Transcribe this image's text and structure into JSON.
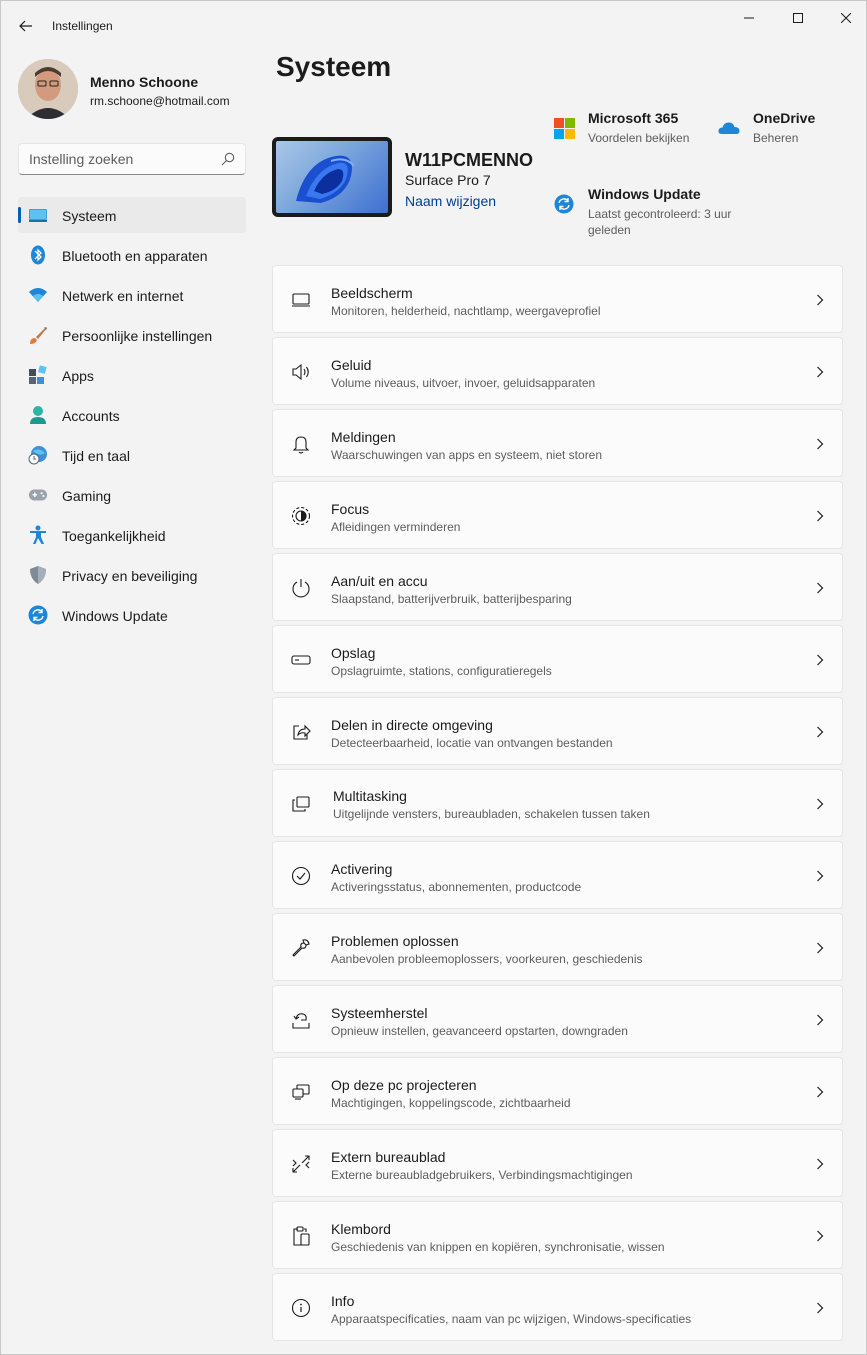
{
  "window": {
    "title": "Instellingen",
    "controls": {
      "minimize": "minimize-icon",
      "maximize": "maximize-icon",
      "close": "close-icon"
    }
  },
  "profile": {
    "name": "Menno Schoone",
    "email": "rm.schoone@hotmail.com"
  },
  "search": {
    "placeholder": "Instelling zoeken",
    "value": ""
  },
  "sidebar": {
    "items": [
      {
        "label": "Systeem",
        "icon": "system-icon",
        "active": true
      },
      {
        "label": "Bluetooth en apparaten",
        "icon": "bluetooth-icon"
      },
      {
        "label": "Netwerk en internet",
        "icon": "wifi-icon"
      },
      {
        "label": "Persoonlijke instellingen",
        "icon": "brush-icon"
      },
      {
        "label": "Apps",
        "icon": "apps-icon"
      },
      {
        "label": "Accounts",
        "icon": "accounts-icon"
      },
      {
        "label": "Tijd en taal",
        "icon": "time-language-icon"
      },
      {
        "label": "Gaming",
        "icon": "gamepad-icon"
      },
      {
        "label": "Toegankelijkheid",
        "icon": "accessibility-icon"
      },
      {
        "label": "Privacy en beveiliging",
        "icon": "shield-icon"
      },
      {
        "label": "Windows Update",
        "icon": "windows-update-icon"
      }
    ]
  },
  "main": {
    "title": "Systeem",
    "device": {
      "name": "W11PCMENNO",
      "model": "Surface Pro 7",
      "rename_link": "Naam wijzigen"
    },
    "quick_links": {
      "m365": {
        "title": "Microsoft 365",
        "subtitle": "Voordelen bekijken",
        "icon": "microsoft-logo-icon"
      },
      "onedrive": {
        "title": "OneDrive",
        "subtitle": "Beheren",
        "icon": "onedrive-icon"
      },
      "update": {
        "title": "Windows Update",
        "subtitle": "Laatst gecontroleerd: 3 uur",
        "subtitle2": "geleden",
        "icon": "windows-update-icon"
      }
    },
    "cards": [
      {
        "title": "Beeldscherm",
        "subtitle": "Monitoren, helderheid, nachtlamp, weergaveprofiel",
        "icon": "display-icon"
      },
      {
        "title": "Geluid",
        "subtitle": "Volume niveaus, uitvoer, invoer, geluidsapparaten",
        "icon": "speaker-icon"
      },
      {
        "title": "Meldingen",
        "subtitle": "Waarschuwingen van apps en systeem, niet storen",
        "icon": "bell-icon"
      },
      {
        "title": "Focus",
        "subtitle": "Afleidingen verminderen",
        "icon": "focus-icon"
      },
      {
        "title": "Aan/uit en accu",
        "subtitle": "Slaapstand, batterijverbruik, batterijbesparing",
        "icon": "power-icon"
      },
      {
        "title": "Opslag",
        "subtitle": "Opslagruimte, stations, configuratieregels",
        "icon": "storage-icon"
      },
      {
        "title": "Delen in directe omgeving",
        "subtitle": "Detecteerbaarheid, locatie van ontvangen bestanden",
        "icon": "share-icon"
      },
      {
        "title": "Multitasking",
        "subtitle": "Uitgelijnde vensters, bureaubladen, schakelen tussen taken",
        "icon": "multitasking-icon"
      },
      {
        "title": "Activering",
        "subtitle": "Activeringsstatus, abonnementen, productcode",
        "icon": "checkmark-circle-icon"
      },
      {
        "title": "Problemen oplossen",
        "subtitle": "Aanbevolen probleemoplossers, voorkeuren, geschiedenis",
        "icon": "wrench-icon"
      },
      {
        "title": "Systeemherstel",
        "subtitle": "Opnieuw instellen, geavanceerd opstarten, downgraden",
        "icon": "recovery-icon"
      },
      {
        "title": "Op deze pc projecteren",
        "subtitle": "Machtigingen, koppelingscode, zichtbaarheid",
        "icon": "project-icon"
      },
      {
        "title": "Extern bureaublad",
        "subtitle": "Externe bureaubladgebruikers, Verbindingsmachtigingen",
        "icon": "remote-desktop-icon"
      },
      {
        "title": "Klembord",
        "subtitle": "Geschiedenis van knippen en kopiëren, synchronisatie, wissen",
        "icon": "clipboard-icon"
      },
      {
        "title": "Info",
        "subtitle": "Apparaatspecificaties, naam van pc wijzigen, Windows-specificaties",
        "icon": "info-icon"
      }
    ]
  },
  "colors": {
    "accent": "#005fb8",
    "link": "#003e92",
    "background": "#f3f3f3",
    "card": "#fbfbfb"
  }
}
